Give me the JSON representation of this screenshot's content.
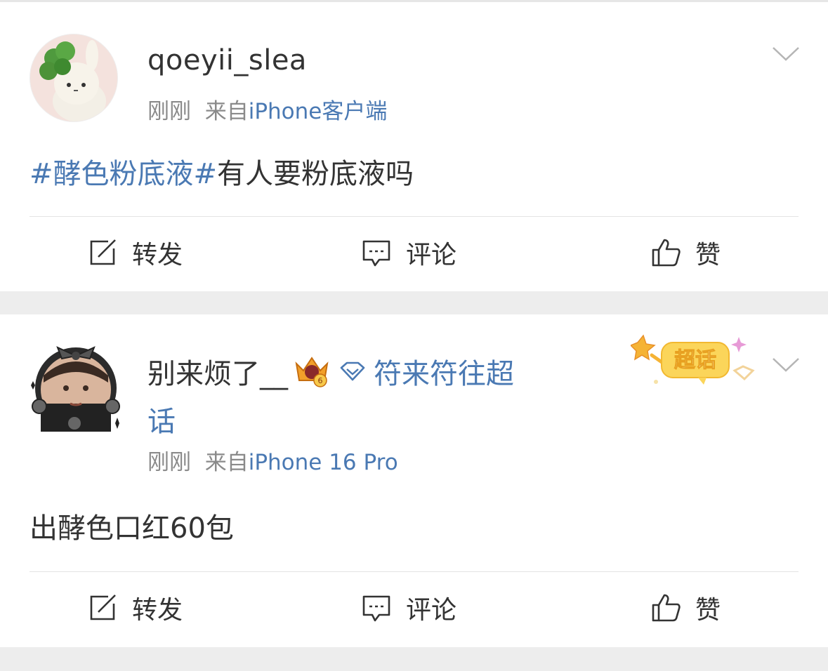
{
  "posts": [
    {
      "username": "qoeyii_slea",
      "time": "刚刚",
      "from_label": "来自",
      "source": "iPhone客户端",
      "topic": "#酵色粉底液#",
      "text": "有人要粉底液吗",
      "actions": {
        "repost": "转发",
        "comment": "评论",
        "like": "赞"
      }
    },
    {
      "username": "别来烦了__",
      "chaohua_link_line1": "符来符往超",
      "chaohua_link_line2": "话",
      "badge_level": "6",
      "time": "刚刚",
      "from_label": "来自",
      "source": "iPhone 16 Pro",
      "text": "出酵色口红60包",
      "super_badge": "超话",
      "actions": {
        "repost": "转发",
        "comment": "评论",
        "like": "赞"
      }
    }
  ],
  "icons": {
    "chevron": "chevron-down-icon",
    "repost": "repost-icon",
    "comment": "comment-icon",
    "like": "thumbs-up-icon",
    "crown": "crown-badge-icon",
    "diamond": "diamond-icon"
  },
  "colors": {
    "link": "#4a79b3",
    "text": "#333333",
    "meta": "#8a8a8a",
    "background": "#ededed",
    "card": "#ffffff"
  }
}
